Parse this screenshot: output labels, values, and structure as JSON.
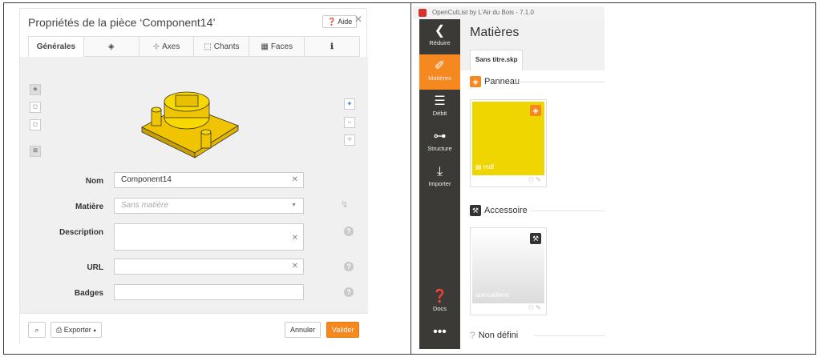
{
  "dialog": {
    "title": "Propriétés de la pièce ‘Component14’",
    "help_label": "Aide",
    "tabs": [
      {
        "label": "Générales",
        "icon": ""
      },
      {
        "label": "",
        "icon": "layers-icon"
      },
      {
        "label": "Axes",
        "icon": "axes-icon"
      },
      {
        "label": "Chants",
        "icon": "edges-icon"
      },
      {
        "label": "Faces",
        "icon": "faces-icon"
      },
      {
        "label": "",
        "icon": "info-icon"
      }
    ],
    "fields": {
      "nom": {
        "label": "Nom",
        "value": "Component14"
      },
      "matiere": {
        "label": "Matière",
        "placeholder": "Sans matière"
      },
      "description": {
        "label": "Description",
        "value": ""
      },
      "url": {
        "label": "URL",
        "value": ""
      },
      "badges": {
        "label": "Badges",
        "value": ""
      }
    },
    "footer": {
      "exporter_label": "Exporter",
      "annuler_label": "Annuler",
      "valider_label": "Valider"
    },
    "colors": {
      "accent": "#f5881f",
      "model": "#f0c400"
    }
  },
  "app": {
    "window_title": "OpenCutList by L'Air du Bois - 7.1.0",
    "sidebar": [
      {
        "label": "Réduire",
        "icon": "chevron-left-icon"
      },
      {
        "label": "Matières",
        "icon": "palette-icon"
      },
      {
        "label": "Débit",
        "icon": "list-icon"
      },
      {
        "label": "Structure",
        "icon": "tree-icon"
      },
      {
        "label": "Importer",
        "icon": "import-icon"
      },
      {
        "label": "Docs",
        "icon": "question-icon"
      },
      {
        "label": "",
        "icon": "more-icon"
      }
    ],
    "page_title": "Matières",
    "file_tab": "Sans titre.skp",
    "sections": {
      "panneau": "Panneau",
      "accessoire": "Accessoire",
      "non_defini": "Non défini"
    },
    "cards": {
      "mdf": {
        "label": "mdf",
        "color": "#efd600"
      },
      "quincaillerie": {
        "label": "quincaillerie",
        "color": "#efefef"
      }
    }
  }
}
